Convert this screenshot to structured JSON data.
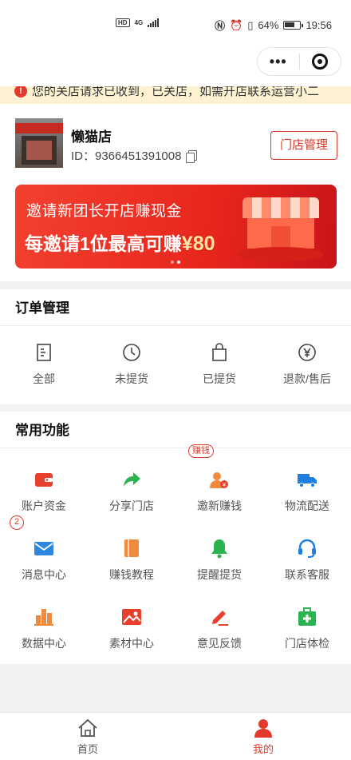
{
  "status_bar": {
    "hd": "HD",
    "network": "4G",
    "battery": "64%",
    "time": "19:56"
  },
  "capsule": {
    "more_label": "•••"
  },
  "notice": {
    "text": "您的关店请求已收到，已关店，如需开店联系运营小二"
  },
  "store": {
    "name": "懒猫店",
    "id_text": "ID：9366451391008",
    "manage_button": "门店管理"
  },
  "banner": {
    "line1": "邀请新团长开店赚现金",
    "line2_prefix": "每邀请1位最高可赚",
    "line2_amount": "¥80"
  },
  "orders": {
    "title": "订单管理",
    "items": [
      {
        "label": "全部",
        "icon": "document-list-icon"
      },
      {
        "label": "未提货",
        "icon": "clock-icon"
      },
      {
        "label": "已提货",
        "icon": "shopping-bag-icon"
      },
      {
        "label": "退款/售后",
        "icon": "yen-circle-icon"
      }
    ]
  },
  "functions": {
    "title": "常用功能",
    "items": [
      {
        "label": "账户资金",
        "icon": "wallet-icon",
        "color": "#e8402f"
      },
      {
        "label": "分享门店",
        "icon": "share-arrow-icon",
        "color": "#2bb34f"
      },
      {
        "label": "邀新赚钱",
        "icon": "invite-money-icon",
        "color": "#f08a3c",
        "badge": "赚钱"
      },
      {
        "label": "物流配送",
        "icon": "truck-icon",
        "color": "#1f7fe0"
      },
      {
        "label": "消息中心",
        "icon": "envelope-icon",
        "color": "#2d86e0",
        "badge": "2"
      },
      {
        "label": "赚钱教程",
        "icon": "book-icon",
        "color": "#f08a3c"
      },
      {
        "label": "提醒提货",
        "icon": "bell-icon",
        "color": "#2bb34f"
      },
      {
        "label": "联系客服",
        "icon": "headset-icon",
        "color": "#1f7fe0"
      },
      {
        "label": "数据中心",
        "icon": "bar-chart-icon",
        "color": "#f08a3c"
      },
      {
        "label": "素材中心",
        "icon": "image-icon",
        "color": "#e8402f"
      },
      {
        "label": "意见反馈",
        "icon": "edit-pen-icon",
        "color": "#e8402f"
      },
      {
        "label": "门店体检",
        "icon": "medical-kit-icon",
        "color": "#2bb34f"
      }
    ]
  },
  "tabbar": {
    "home": "首页",
    "mine": "我的"
  },
  "colors": {
    "accent": "#e23b2e",
    "notice_bg": "#fdf3d2"
  }
}
